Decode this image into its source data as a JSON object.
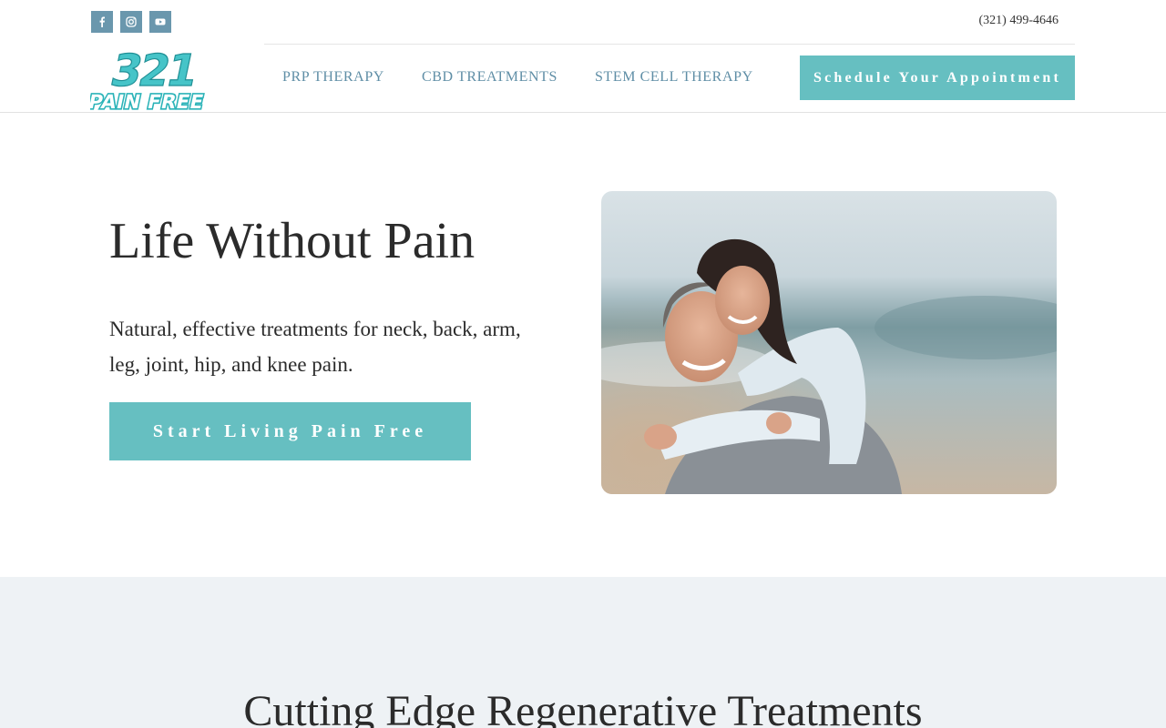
{
  "header": {
    "social": [
      {
        "icon": "facebook-icon"
      },
      {
        "icon": "instagram-icon"
      },
      {
        "icon": "youtube-icon"
      }
    ],
    "phone": "(321) 499-4646",
    "logo": {
      "line1": "321",
      "line2": "PAIN FREE"
    },
    "nav": [
      "PRP THERAPY",
      "CBD TREATMENTS",
      "STEM CELL THERAPY"
    ],
    "cta_label": "Schedule Your Appointment"
  },
  "hero": {
    "title": "Life Without Pain",
    "subtitle": "Natural, effective treatments for neck, back, arm, leg, joint, hip, and knee pain.",
    "cta_label": "Start Living Pain Free"
  },
  "section2": {
    "title": "Cutting Edge Regenerative Treatments"
  },
  "colors": {
    "accent": "#66bfc1",
    "nav_text": "#5f8ea6",
    "social_bg": "#6a97ad",
    "section_bg": "#eef2f5",
    "text": "#2b2b2b"
  }
}
